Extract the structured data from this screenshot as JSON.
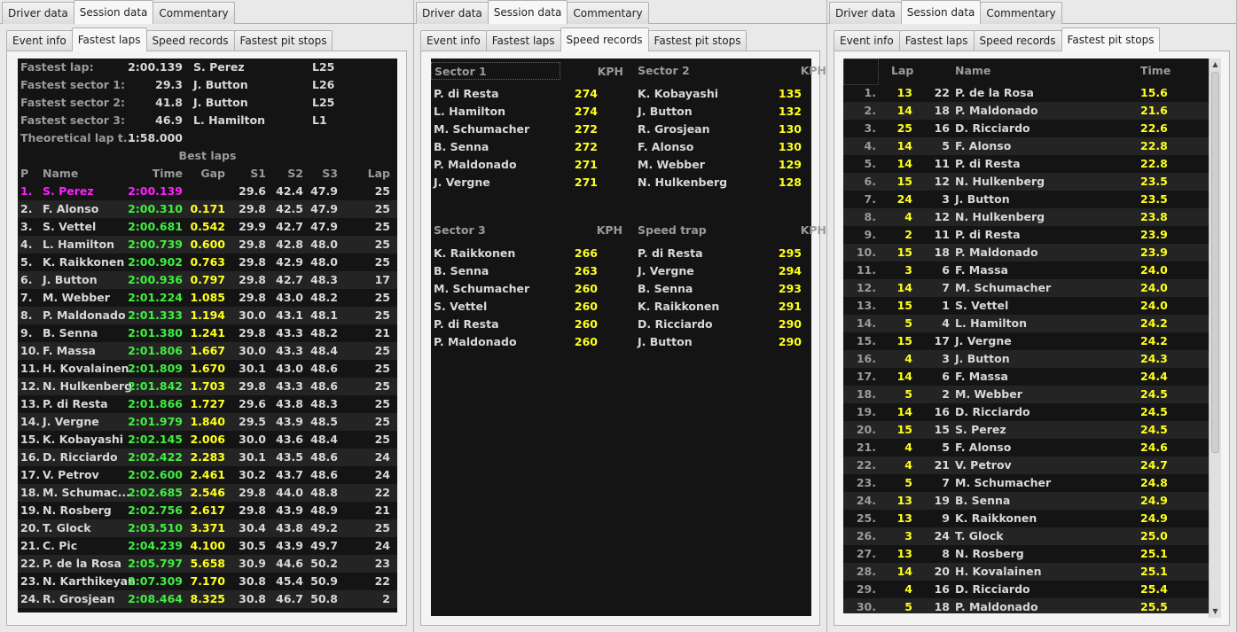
{
  "main_tabs": [
    "Driver data",
    "Session data",
    "Commentary"
  ],
  "panel1": {
    "sub_tabs": [
      "Event info",
      "Fastest laps",
      "Speed records",
      "Fastest pit stops"
    ],
    "summary": [
      {
        "label": "Fastest lap:",
        "value": "2:00.139",
        "driver": "S. Perez",
        "lap": "L25"
      },
      {
        "label": "Fastest sector 1:",
        "value": "29.3",
        "driver": "J. Button",
        "lap": "L26"
      },
      {
        "label": "Fastest sector 2:",
        "value": "41.8",
        "driver": "J. Button",
        "lap": "L25"
      },
      {
        "label": "Fastest sector 3:",
        "value": "46.9",
        "driver": "L. Hamilton",
        "lap": "L1"
      },
      {
        "label": "Theoretical lap t...",
        "value": "1:58.000",
        "driver": "",
        "lap": ""
      }
    ],
    "best_laps_title": "Best laps",
    "headers": {
      "p": "P",
      "name": "Name",
      "time": "Time",
      "gap": "Gap",
      "s1": "S1",
      "s2": "S2",
      "s3": "S3",
      "lap": "Lap"
    },
    "rows": [
      {
        "p": "1.",
        "name": "S. Perez",
        "time": "2:00.139",
        "gap": "",
        "s1": "29.6",
        "s2": "42.4",
        "s3": "47.9",
        "lap": "25"
      },
      {
        "p": "2.",
        "name": "F. Alonso",
        "time": "2:00.310",
        "gap": "0.171",
        "s1": "29.8",
        "s2": "42.5",
        "s3": "47.9",
        "lap": "25"
      },
      {
        "p": "3.",
        "name": "S. Vettel",
        "time": "2:00.681",
        "gap": "0.542",
        "s1": "29.9",
        "s2": "42.7",
        "s3": "47.9",
        "lap": "25"
      },
      {
        "p": "4.",
        "name": "L. Hamilton",
        "time": "2:00.739",
        "gap": "0.600",
        "s1": "29.8",
        "s2": "42.8",
        "s3": "48.0",
        "lap": "25"
      },
      {
        "p": "5.",
        "name": "K. Raikkonen",
        "time": "2:00.902",
        "gap": "0.763",
        "s1": "29.8",
        "s2": "42.9",
        "s3": "48.0",
        "lap": "25"
      },
      {
        "p": "6.",
        "name": "J. Button",
        "time": "2:00.936",
        "gap": "0.797",
        "s1": "29.8",
        "s2": "42.7",
        "s3": "48.3",
        "lap": "17"
      },
      {
        "p": "7.",
        "name": "M. Webber",
        "time": "2:01.224",
        "gap": "1.085",
        "s1": "29.8",
        "s2": "43.0",
        "s3": "48.2",
        "lap": "25"
      },
      {
        "p": "8.",
        "name": "P. Maldonado",
        "time": "2:01.333",
        "gap": "1.194",
        "s1": "30.0",
        "s2": "43.1",
        "s3": "48.1",
        "lap": "25"
      },
      {
        "p": "9.",
        "name": "B. Senna",
        "time": "2:01.380",
        "gap": "1.241",
        "s1": "29.8",
        "s2": "43.3",
        "s3": "48.2",
        "lap": "21"
      },
      {
        "p": "10.",
        "name": "F. Massa",
        "time": "2:01.806",
        "gap": "1.667",
        "s1": "30.0",
        "s2": "43.3",
        "s3": "48.4",
        "lap": "25"
      },
      {
        "p": "11.",
        "name": "H. Kovalainen",
        "time": "2:01.809",
        "gap": "1.670",
        "s1": "30.1",
        "s2": "43.0",
        "s3": "48.6",
        "lap": "25"
      },
      {
        "p": "12.",
        "name": "N. Hulkenberg",
        "time": "2:01.842",
        "gap": "1.703",
        "s1": "29.8",
        "s2": "43.3",
        "s3": "48.6",
        "lap": "25"
      },
      {
        "p": "13.",
        "name": "P. di Resta",
        "time": "2:01.866",
        "gap": "1.727",
        "s1": "29.6",
        "s2": "43.8",
        "s3": "48.3",
        "lap": "25"
      },
      {
        "p": "14.",
        "name": "J. Vergne",
        "time": "2:01.979",
        "gap": "1.840",
        "s1": "29.5",
        "s2": "43.9",
        "s3": "48.5",
        "lap": "25"
      },
      {
        "p": "15.",
        "name": "K. Kobayashi",
        "time": "2:02.145",
        "gap": "2.006",
        "s1": "30.0",
        "s2": "43.6",
        "s3": "48.4",
        "lap": "25"
      },
      {
        "p": "16.",
        "name": "D. Ricciardo",
        "time": "2:02.422",
        "gap": "2.283",
        "s1": "30.1",
        "s2": "43.5",
        "s3": "48.6",
        "lap": "24"
      },
      {
        "p": "17.",
        "name": "V. Petrov",
        "time": "2:02.600",
        "gap": "2.461",
        "s1": "30.2",
        "s2": "43.7",
        "s3": "48.6",
        "lap": "24"
      },
      {
        "p": "18.",
        "name": "M. Schumac...",
        "time": "2:02.685",
        "gap": "2.546",
        "s1": "29.8",
        "s2": "44.0",
        "s3": "48.8",
        "lap": "22"
      },
      {
        "p": "19.",
        "name": "N. Rosberg",
        "time": "2:02.756",
        "gap": "2.617",
        "s1": "29.8",
        "s2": "43.9",
        "s3": "48.9",
        "lap": "21"
      },
      {
        "p": "20.",
        "name": "T. Glock",
        "time": "2:03.510",
        "gap": "3.371",
        "s1": "30.4",
        "s2": "43.8",
        "s3": "49.2",
        "lap": "25"
      },
      {
        "p": "21.",
        "name": "C. Pic",
        "time": "2:04.239",
        "gap": "4.100",
        "s1": "30.5",
        "s2": "43.9",
        "s3": "49.7",
        "lap": "24"
      },
      {
        "p": "22.",
        "name": "P. de la Rosa",
        "time": "2:05.797",
        "gap": "5.658",
        "s1": "30.9",
        "s2": "44.6",
        "s3": "50.2",
        "lap": "23"
      },
      {
        "p": "23.",
        "name": "N. Karthikeyan",
        "time": "2:07.309",
        "gap": "7.170",
        "s1": "30.8",
        "s2": "45.4",
        "s3": "50.9",
        "lap": "22"
      },
      {
        "p": "24.",
        "name": "R. Grosjean",
        "time": "2:08.464",
        "gap": "8.325",
        "s1": "30.8",
        "s2": "46.7",
        "s3": "50.8",
        "lap": "2"
      }
    ]
  },
  "panel2": {
    "sub_tabs": [
      "Event info",
      "Fastest laps",
      "Speed records",
      "Fastest pit stops"
    ],
    "unit": "KPH",
    "blocks": [
      {
        "title": "Sector 1",
        "rows": [
          [
            "P. di Resta",
            "274"
          ],
          [
            "L. Hamilton",
            "274"
          ],
          [
            "M. Schumacher",
            "272"
          ],
          [
            "B. Senna",
            "272"
          ],
          [
            "P. Maldonado",
            "271"
          ],
          [
            "J. Vergne",
            "271"
          ]
        ]
      },
      {
        "title": "Sector 2",
        "rows": [
          [
            "K. Kobayashi",
            "135"
          ],
          [
            "J. Button",
            "132"
          ],
          [
            "R. Grosjean",
            "130"
          ],
          [
            "F. Alonso",
            "130"
          ],
          [
            "M. Webber",
            "129"
          ],
          [
            "N. Hulkenberg",
            "128"
          ]
        ]
      },
      {
        "title": "Sector 3",
        "rows": [
          [
            "K. Raikkonen",
            "266"
          ],
          [
            "B. Senna",
            "263"
          ],
          [
            "M. Schumacher",
            "260"
          ],
          [
            "S. Vettel",
            "260"
          ],
          [
            "P. di Resta",
            "260"
          ],
          [
            "P. Maldonado",
            "260"
          ]
        ]
      },
      {
        "title": "Speed trap",
        "rows": [
          [
            "P. di Resta",
            "295"
          ],
          [
            "J. Vergne",
            "294"
          ],
          [
            "B. Senna",
            "293"
          ],
          [
            "K. Raikkonen",
            "291"
          ],
          [
            "D. Ricciardo",
            "290"
          ],
          [
            "J. Button",
            "290"
          ]
        ]
      }
    ]
  },
  "panel3": {
    "sub_tabs": [
      "Event info",
      "Fastest laps",
      "Speed records",
      "Fastest pit stops"
    ],
    "headers": {
      "lap": "Lap",
      "name": "Name",
      "time": "Time"
    },
    "rows": [
      [
        "1.",
        "13",
        "22",
        "P. de la Rosa",
        "15.6"
      ],
      [
        "2.",
        "14",
        "18",
        "P. Maldonado",
        "21.6"
      ],
      [
        "3.",
        "25",
        "16",
        "D. Ricciardo",
        "22.6"
      ],
      [
        "4.",
        "14",
        "5",
        "F. Alonso",
        "22.8"
      ],
      [
        "5.",
        "14",
        "11",
        "P. di Resta",
        "22.8"
      ],
      [
        "6.",
        "15",
        "12",
        "N. Hulkenberg",
        "23.5"
      ],
      [
        "7.",
        "24",
        "3",
        "J. Button",
        "23.5"
      ],
      [
        "8.",
        "4",
        "12",
        "N. Hulkenberg",
        "23.8"
      ],
      [
        "9.",
        "2",
        "11",
        "P. di Resta",
        "23.9"
      ],
      [
        "10.",
        "15",
        "18",
        "P. Maldonado",
        "23.9"
      ],
      [
        "11.",
        "3",
        "6",
        "F. Massa",
        "24.0"
      ],
      [
        "12.",
        "14",
        "7",
        "M. Schumacher",
        "24.0"
      ],
      [
        "13.",
        "15",
        "1",
        "S. Vettel",
        "24.0"
      ],
      [
        "14.",
        "5",
        "4",
        "L. Hamilton",
        "24.2"
      ],
      [
        "15.",
        "15",
        "17",
        "J. Vergne",
        "24.2"
      ],
      [
        "16.",
        "4",
        "3",
        "J. Button",
        "24.3"
      ],
      [
        "17.",
        "14",
        "6",
        "F. Massa",
        "24.4"
      ],
      [
        "18.",
        "5",
        "2",
        "M. Webber",
        "24.5"
      ],
      [
        "19.",
        "14",
        "16",
        "D. Ricciardo",
        "24.5"
      ],
      [
        "20.",
        "15",
        "15",
        "S. Perez",
        "24.5"
      ],
      [
        "21.",
        "4",
        "5",
        "F. Alonso",
        "24.6"
      ],
      [
        "22.",
        "4",
        "21",
        "V. Petrov",
        "24.7"
      ],
      [
        "23.",
        "5",
        "7",
        "M. Schumacher",
        "24.8"
      ],
      [
        "24.",
        "13",
        "19",
        "B. Senna",
        "24.9"
      ],
      [
        "25.",
        "13",
        "9",
        "K. Raikkonen",
        "24.9"
      ],
      [
        "26.",
        "3",
        "24",
        "T. Glock",
        "25.0"
      ],
      [
        "27.",
        "13",
        "8",
        "N. Rosberg",
        "25.1"
      ],
      [
        "28.",
        "14",
        "20",
        "H. Kovalainen",
        "25.1"
      ],
      [
        "29.",
        "4",
        "16",
        "D. Ricciardo",
        "25.4"
      ],
      [
        "30.",
        "5",
        "18",
        "P. Maldonado",
        "25.5"
      ]
    ]
  },
  "colors": {
    "bg": "#141414",
    "alt": "#242424",
    "label": "#9a9a9a",
    "time": "#3ef03e",
    "value": "#ffff1e",
    "fastest": "#ff1eff"
  }
}
